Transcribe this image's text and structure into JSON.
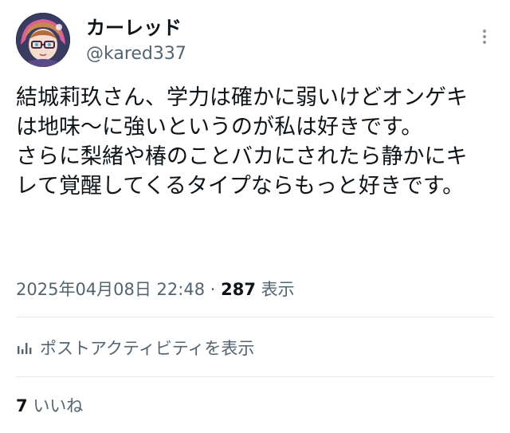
{
  "author": {
    "display_name": "カーレッド",
    "handle": "@kared337",
    "avatar_icon": "user-avatar-icon"
  },
  "tweet": {
    "text": "結城莉玖さん、学力は確かに弱いけどオンゲキは地味〜に強いというのが私は好きです。\nさらに梨緒や椿のことバカにされたら静かにキレて覚醒してくるタイプならもっと好きです。",
    "timestamp": "2025年04月08日 22:48",
    "separator": " · ",
    "views_count": "287",
    "views_label": "表示"
  },
  "actions": {
    "more_icon": "more-vertical-icon",
    "activity_icon": "analytics-bars-icon",
    "activity_label": "ポストアクティビティを表示"
  },
  "engagement": {
    "likes_count": "7",
    "likes_label": "いいね"
  },
  "colors": {
    "text_primary": "#0f1419",
    "text_secondary": "#536471",
    "divider": "#e4e8eb"
  }
}
